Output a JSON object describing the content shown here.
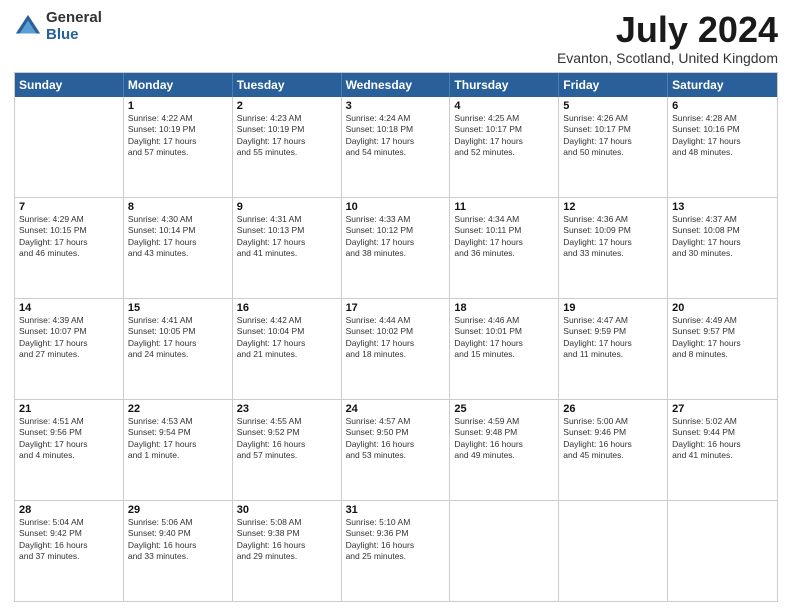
{
  "header": {
    "logo_general": "General",
    "logo_blue": "Blue",
    "month_title": "July 2024",
    "location": "Evanton, Scotland, United Kingdom"
  },
  "calendar": {
    "days_of_week": [
      "Sunday",
      "Monday",
      "Tuesday",
      "Wednesday",
      "Thursday",
      "Friday",
      "Saturday"
    ],
    "weeks": [
      [
        {
          "day": "",
          "info": ""
        },
        {
          "day": "1",
          "info": "Sunrise: 4:22 AM\nSunset: 10:19 PM\nDaylight: 17 hours\nand 57 minutes."
        },
        {
          "day": "2",
          "info": "Sunrise: 4:23 AM\nSunset: 10:19 PM\nDaylight: 17 hours\nand 55 minutes."
        },
        {
          "day": "3",
          "info": "Sunrise: 4:24 AM\nSunset: 10:18 PM\nDaylight: 17 hours\nand 54 minutes."
        },
        {
          "day": "4",
          "info": "Sunrise: 4:25 AM\nSunset: 10:17 PM\nDaylight: 17 hours\nand 52 minutes."
        },
        {
          "day": "5",
          "info": "Sunrise: 4:26 AM\nSunset: 10:17 PM\nDaylight: 17 hours\nand 50 minutes."
        },
        {
          "day": "6",
          "info": "Sunrise: 4:28 AM\nSunset: 10:16 PM\nDaylight: 17 hours\nand 48 minutes."
        }
      ],
      [
        {
          "day": "7",
          "info": "Sunrise: 4:29 AM\nSunset: 10:15 PM\nDaylight: 17 hours\nand 46 minutes."
        },
        {
          "day": "8",
          "info": "Sunrise: 4:30 AM\nSunset: 10:14 PM\nDaylight: 17 hours\nand 43 minutes."
        },
        {
          "day": "9",
          "info": "Sunrise: 4:31 AM\nSunset: 10:13 PM\nDaylight: 17 hours\nand 41 minutes."
        },
        {
          "day": "10",
          "info": "Sunrise: 4:33 AM\nSunset: 10:12 PM\nDaylight: 17 hours\nand 38 minutes."
        },
        {
          "day": "11",
          "info": "Sunrise: 4:34 AM\nSunset: 10:11 PM\nDaylight: 17 hours\nand 36 minutes."
        },
        {
          "day": "12",
          "info": "Sunrise: 4:36 AM\nSunset: 10:09 PM\nDaylight: 17 hours\nand 33 minutes."
        },
        {
          "day": "13",
          "info": "Sunrise: 4:37 AM\nSunset: 10:08 PM\nDaylight: 17 hours\nand 30 minutes."
        }
      ],
      [
        {
          "day": "14",
          "info": "Sunrise: 4:39 AM\nSunset: 10:07 PM\nDaylight: 17 hours\nand 27 minutes."
        },
        {
          "day": "15",
          "info": "Sunrise: 4:41 AM\nSunset: 10:05 PM\nDaylight: 17 hours\nand 24 minutes."
        },
        {
          "day": "16",
          "info": "Sunrise: 4:42 AM\nSunset: 10:04 PM\nDaylight: 17 hours\nand 21 minutes."
        },
        {
          "day": "17",
          "info": "Sunrise: 4:44 AM\nSunset: 10:02 PM\nDaylight: 17 hours\nand 18 minutes."
        },
        {
          "day": "18",
          "info": "Sunrise: 4:46 AM\nSunset: 10:01 PM\nDaylight: 17 hours\nand 15 minutes."
        },
        {
          "day": "19",
          "info": "Sunrise: 4:47 AM\nSunset: 9:59 PM\nDaylight: 17 hours\nand 11 minutes."
        },
        {
          "day": "20",
          "info": "Sunrise: 4:49 AM\nSunset: 9:57 PM\nDaylight: 17 hours\nand 8 minutes."
        }
      ],
      [
        {
          "day": "21",
          "info": "Sunrise: 4:51 AM\nSunset: 9:56 PM\nDaylight: 17 hours\nand 4 minutes."
        },
        {
          "day": "22",
          "info": "Sunrise: 4:53 AM\nSunset: 9:54 PM\nDaylight: 17 hours\nand 1 minute."
        },
        {
          "day": "23",
          "info": "Sunrise: 4:55 AM\nSunset: 9:52 PM\nDaylight: 16 hours\nand 57 minutes."
        },
        {
          "day": "24",
          "info": "Sunrise: 4:57 AM\nSunset: 9:50 PM\nDaylight: 16 hours\nand 53 minutes."
        },
        {
          "day": "25",
          "info": "Sunrise: 4:59 AM\nSunset: 9:48 PM\nDaylight: 16 hours\nand 49 minutes."
        },
        {
          "day": "26",
          "info": "Sunrise: 5:00 AM\nSunset: 9:46 PM\nDaylight: 16 hours\nand 45 minutes."
        },
        {
          "day": "27",
          "info": "Sunrise: 5:02 AM\nSunset: 9:44 PM\nDaylight: 16 hours\nand 41 minutes."
        }
      ],
      [
        {
          "day": "28",
          "info": "Sunrise: 5:04 AM\nSunset: 9:42 PM\nDaylight: 16 hours\nand 37 minutes."
        },
        {
          "day": "29",
          "info": "Sunrise: 5:06 AM\nSunset: 9:40 PM\nDaylight: 16 hours\nand 33 minutes."
        },
        {
          "day": "30",
          "info": "Sunrise: 5:08 AM\nSunset: 9:38 PM\nDaylight: 16 hours\nand 29 minutes."
        },
        {
          "day": "31",
          "info": "Sunrise: 5:10 AM\nSunset: 9:36 PM\nDaylight: 16 hours\nand 25 minutes."
        },
        {
          "day": "",
          "info": ""
        },
        {
          "day": "",
          "info": ""
        },
        {
          "day": "",
          "info": ""
        }
      ]
    ]
  }
}
